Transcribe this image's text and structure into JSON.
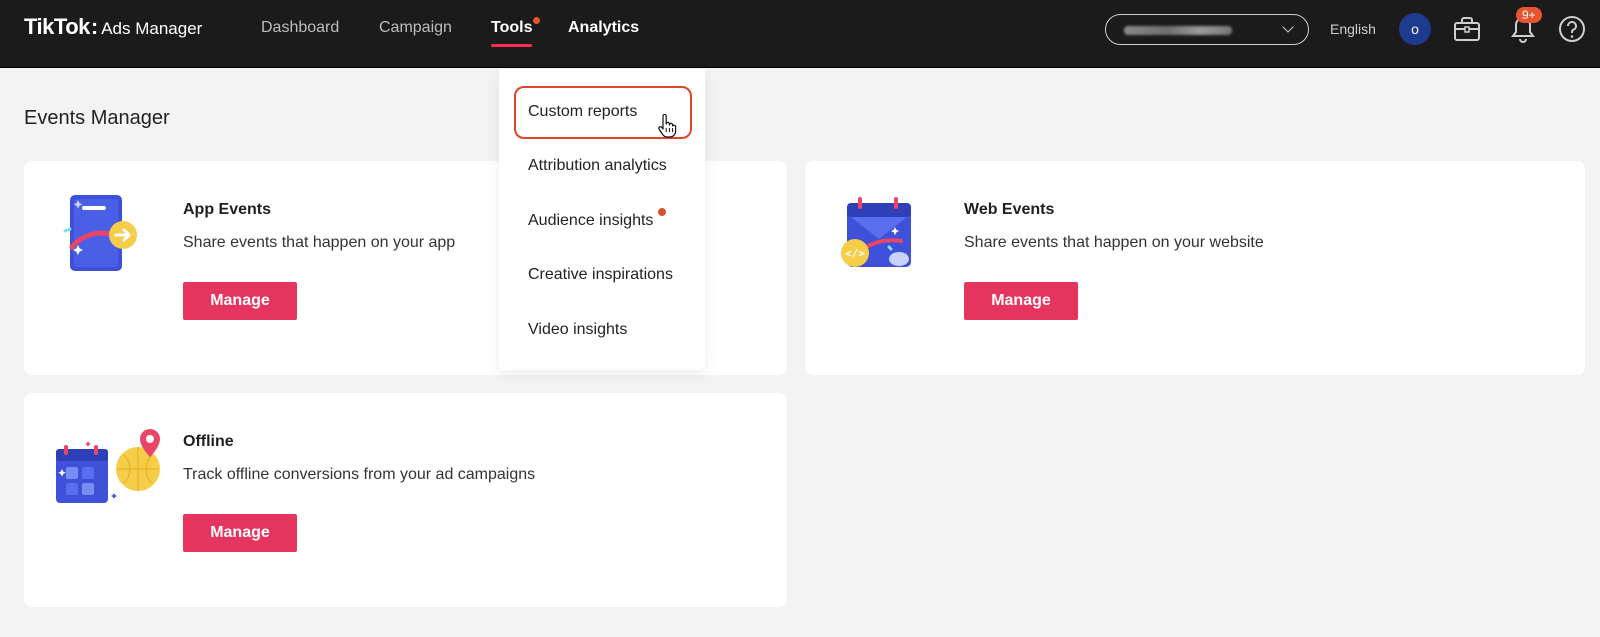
{
  "header": {
    "logo_brand": "TikTok",
    "logo_colon": ":",
    "logo_product": "Ads Manager",
    "nav": [
      {
        "label": "Dashboard"
      },
      {
        "label": "Campaign"
      },
      {
        "label": "Tools"
      },
      {
        "label": "Analytics"
      }
    ],
    "language": "English",
    "avatar_initial": "o",
    "notifications_badge": "9+"
  },
  "page": {
    "title": "Events Manager"
  },
  "cards": {
    "app": {
      "title": "App Events",
      "description": "Share events that happen on your app",
      "button": "Manage"
    },
    "web": {
      "title": "Web Events",
      "description": "Share events that happen on your website",
      "button": "Manage"
    },
    "offline": {
      "title": "Offline",
      "description": "Track offline conversions from your ad campaigns",
      "button": "Manage"
    }
  },
  "tools_menu": {
    "items": [
      {
        "label": "Custom reports"
      },
      {
        "label": "Attribution analytics"
      },
      {
        "label": "Audience insights"
      },
      {
        "label": "Creative inspirations"
      },
      {
        "label": "Video insights"
      }
    ]
  },
  "colors": {
    "topbar": "#1b1b1b",
    "accent": "#e5355f",
    "highlight": "#e0452a",
    "notification": "#e8542f"
  }
}
